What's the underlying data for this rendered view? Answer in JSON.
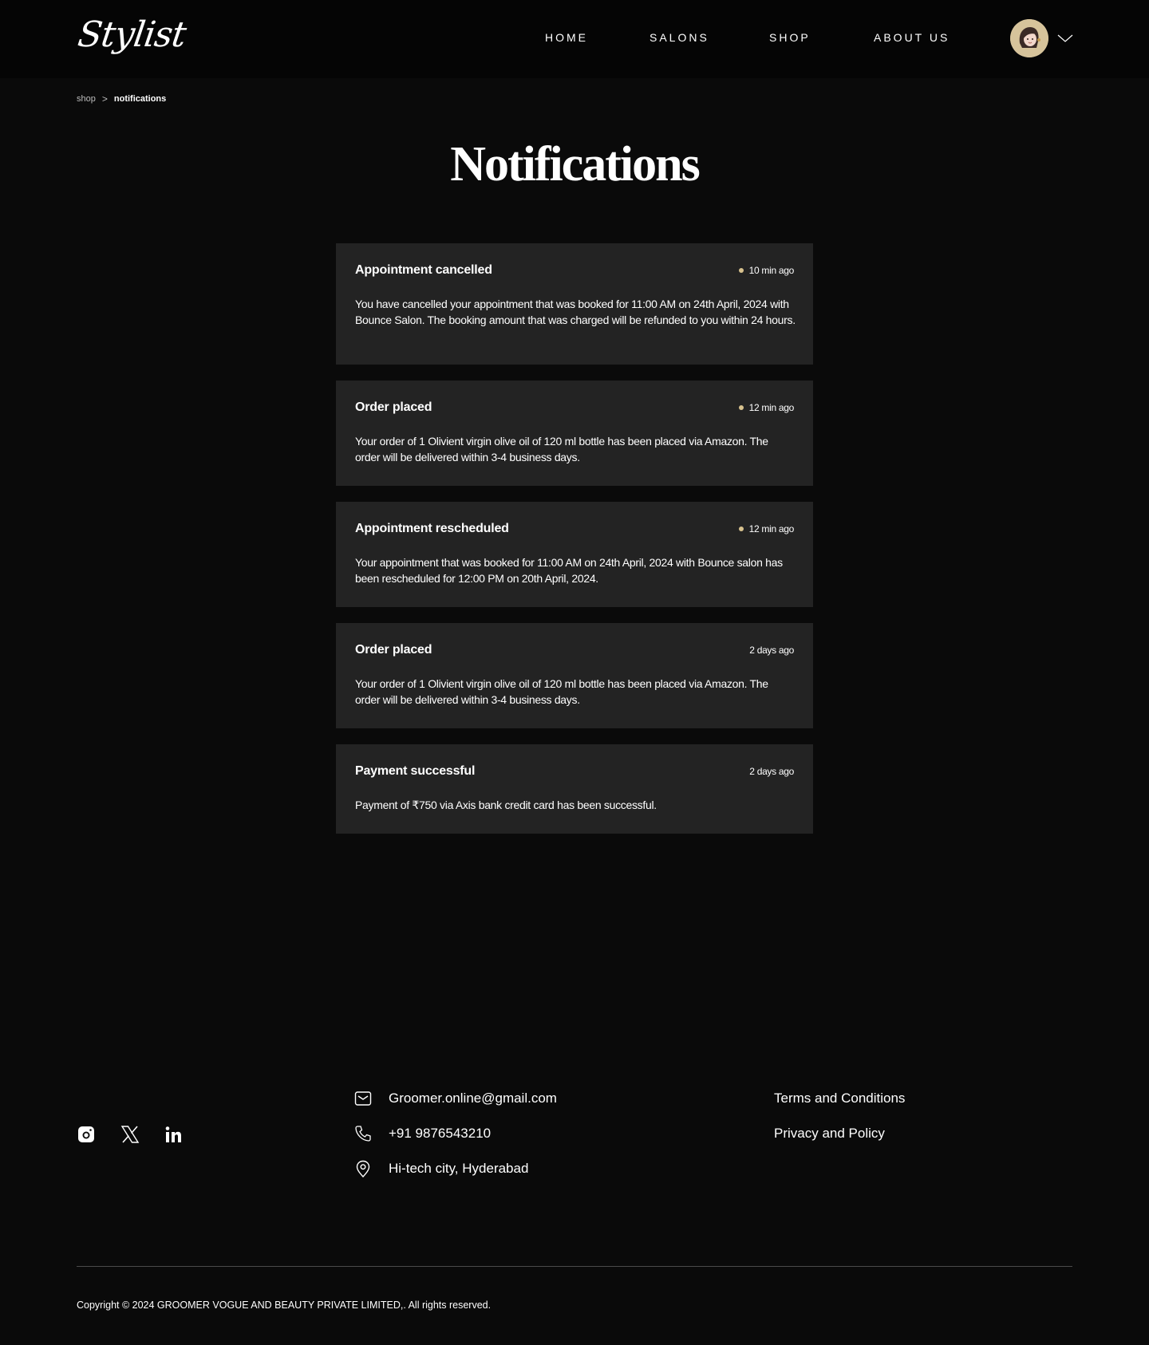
{
  "header": {
    "logo": "Stylist",
    "nav": [
      {
        "label": "HOME"
      },
      {
        "label": "SALONS"
      },
      {
        "label": "SHOP"
      },
      {
        "label": "ABOUT US"
      }
    ]
  },
  "breadcrumb": {
    "parent": "shop",
    "separator": ">",
    "current": "notifications"
  },
  "page": {
    "title": "Notifications"
  },
  "notifications": [
    {
      "title": "Appointment cancelled",
      "time": "10 min ago",
      "unread": true,
      "body": "You have cancelled your appointment that was booked for 11:00 AM on 24th April, 2024 with Bounce Salon. The booking amount that was charged will be refunded to you within 24 hours."
    },
    {
      "title": "Order placed",
      "time": "12 min ago",
      "unread": true,
      "body": "Your order of 1 Olivient virgin olive oil of 120 ml bottle has been placed via Amazon. The order will be delivered within 3-4 business days."
    },
    {
      "title": "Appointment rescheduled",
      "time": "12 min ago",
      "unread": true,
      "body": "Your appointment that was booked for 11:00 AM on 24th April, 2024 with Bounce salon has been rescheduled for 12:00 PM on 20th April, 2024."
    },
    {
      "title": "Order placed",
      "time": "2 days ago",
      "unread": false,
      "body": "Your order of 1 Olivient virgin olive oil of 120 ml bottle has been placed via Amazon. The order will be delivered within 3-4 business days."
    },
    {
      "title": "Payment successful",
      "time": "2 days ago",
      "unread": false,
      "body": "Payment of ₹750 via Axis bank credit card has been successful."
    }
  ],
  "footer": {
    "social": [
      {
        "icon": "instagram-icon"
      },
      {
        "icon": "x-twitter-icon"
      },
      {
        "icon": "linkedin-icon"
      }
    ],
    "contact": {
      "email": "Groomer.online@gmail.com",
      "phone": "+91 9876543210",
      "address": "Hi-tech city, Hyderabad"
    },
    "links": {
      "terms": "Terms and Conditions",
      "privacy": "Privacy and Policy"
    },
    "copyright": "Copyright  ©  2024 GROOMER VOGUE AND BEAUTY PRIVATE LIMITED,. All rights reserved."
  },
  "colors": {
    "background": "#0a0a0a",
    "header_bg": "#050505",
    "card_bg": "#232323",
    "unread_dot": "#d8c28e",
    "avatar_bg": "#d6c39b"
  }
}
